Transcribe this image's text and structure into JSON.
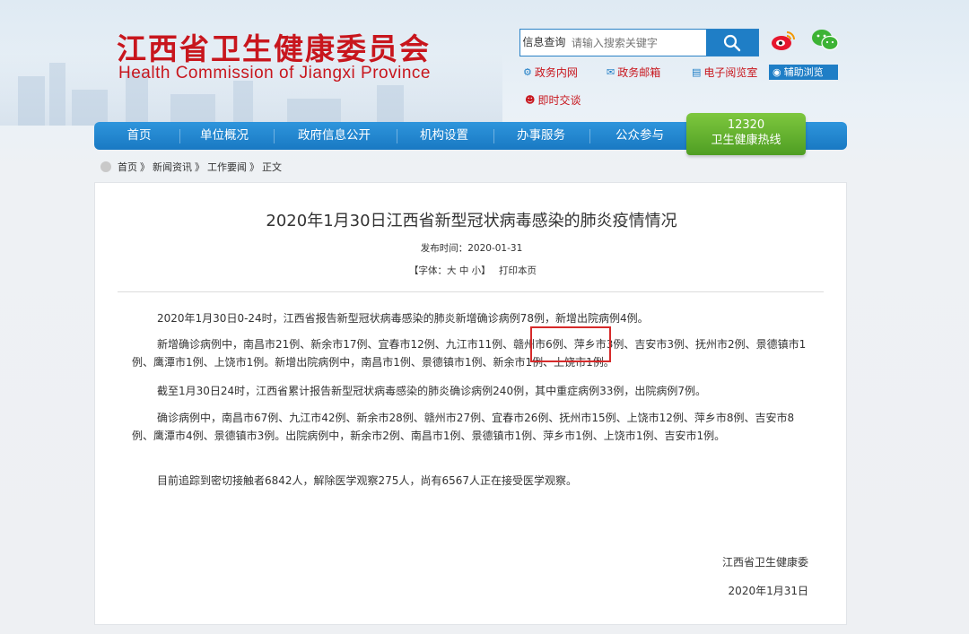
{
  "header": {
    "title_cn": "江西省卫生健康委员会",
    "title_en": "Health Commission of Jiangxi Province"
  },
  "search": {
    "category": "信息查询",
    "placeholder": "请输入搜索关键字"
  },
  "social": {
    "weibo_icon": "weibo-icon",
    "wechat_icon": "wechat-icon"
  },
  "quick_links": {
    "intranet": "政务内网",
    "mailbox": "政务邮箱",
    "e_reading": "电子阅览室",
    "assist_browse": "辅助浏览",
    "instant_chat": "即时交谈"
  },
  "nav": {
    "items": [
      "首页",
      "单位概况",
      "政府信息公开",
      "机构设置",
      "办事服务",
      "公众参与"
    ],
    "hotline_number": "12320",
    "hotline_label": "卫生健康热线"
  },
  "breadcrumb": [
    "首页",
    "》",
    "新闻资讯",
    "》",
    "工作要闻",
    "》",
    "正文"
  ],
  "article": {
    "title": "2020年1月30日江西省新型冠状病毒感染的肺炎疫情情况",
    "pubdate": "发布时间：2020-01-31",
    "font_control": "【字体：大 中 小】",
    "print": "打印本页",
    "paragraphs": [
      "2020年1月30日0-24时，江西省报告新型冠状病毒感染的肺炎新增确诊病例78例，新增出院病例4例。",
      "新增确诊病例中，南昌市21例、新余市17例、宜春市12例、九江市11例、赣州市6例、萍乡市3例、吉安市3例、抚州市2例、景德镇市1例、鹰潭市1例、上饶市1例。新增出院病例中，南昌市1例、景德镇市1例、新余市1例、上饶市1例。",
      "截至1月30日24时，江西省累计报告新型冠状病毒感染的肺炎确诊病例240例，其中重症病例33例，出院病例7例。",
      "确诊病例中，南昌市67例、九江市42例、新余市28例、赣州市27例、宜春市26例、抚州市15例、上饶市12例、萍乡市8例、吉安市8例、鹰潭市4例、景德镇市3例。出院病例中，新余市2例、南昌市1例、景德镇市1例、萍乡市1例、上饶市1例、吉安市1例。",
      "目前追踪到密切接触者6842人，解除医学观察275人，尚有6567人正在接受医学观察。"
    ],
    "signature": "江西省卫生健康委",
    "sign_date": "2020年1月31日"
  },
  "colors": {
    "brand_red": "#c8161d",
    "nav_blue": "#1f7ec6",
    "hotline_green": "#5aa82b",
    "highlight_red": "#d62a2a"
  }
}
